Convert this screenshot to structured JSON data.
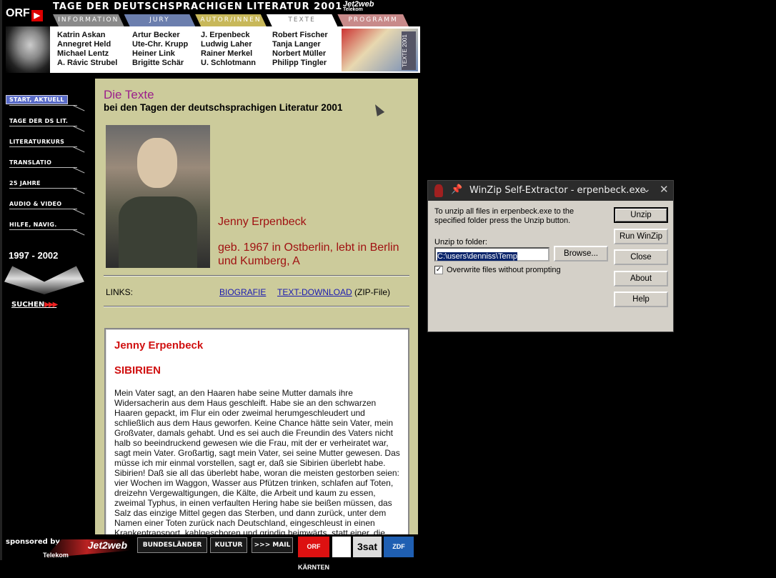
{
  "header": {
    "brand": "ORF",
    "title": "TAGE DER DEUTSCHSPRACHIGEN LITERATUR 2001",
    "sponsor": "Jet2web",
    "sponsor_sub": "Telekom",
    "tabs": [
      "INFORMATION",
      "JURY",
      "AUTOR/INNEN",
      "TEXTE",
      "PROGRAMM"
    ],
    "active_tab": "TEXTE",
    "banner_label": "TEXTE 2001"
  },
  "authors": [
    "Katrin Askan",
    "Artur Becker",
    "J. Erpenbeck",
    "Robert Fischer",
    "Annegret Held",
    "Ute-Chr. Krupp",
    "Ludwig Laher",
    "Tanja Langer",
    "Michael Lentz",
    "Heiner Link",
    "Rainer Merkel",
    "Norbert Müller",
    "A. Rávic Strubel",
    "Brigitte Schär",
    "U. Schlotmann",
    "Philipp Tingler"
  ],
  "sidebar": {
    "items": [
      {
        "label": "START, AKTUELL",
        "active": true
      },
      {
        "label": "TAGE DER DS LIT.",
        "active": false
      },
      {
        "label": "LITERATURKURS",
        "active": false
      },
      {
        "label": "TRANSLATIO",
        "active": false
      },
      {
        "label": "25 JAHRE",
        "active": false
      },
      {
        "label": "AUDIO & VIDEO",
        "active": false
      },
      {
        "label": "HILFE, NAVIG.",
        "active": false
      }
    ],
    "years": "1997 - 2002",
    "search": "SUCHEN",
    "search_arrows": "▶▶▶"
  },
  "main": {
    "heading": "Die Texte",
    "subheading": "bei den Tagen der deutschsprachigen Literatur 2001",
    "author_name": "Jenny Erpenbeck",
    "author_bio": "geb. 1967 in Ostberlin, lebt in Berlin und Kumberg, A",
    "links_label": "LINKS:",
    "link_bio": "BIOGRAFIE",
    "link_download": "TEXT-DOWNLOAD",
    "link_download_note": "(ZIP-File)",
    "text_author": "Jenny Erpenbeck",
    "text_title": "SIBIRIEN",
    "text_body": "Mein Vater sagt, an den Haaren habe seine Mutter damals ihre Widersacherin aus dem Haus geschleift. Habe sie an den schwarzen Haaren gepackt, im Flur ein oder zweimal herumgeschleudert und schließlich aus dem Haus geworfen. Keine Chance hätte sein Vater, mein Großvater, damals gehabt. Und es sei auch die Freundin des Vaters nicht halb so beeindruckend gewesen wie die Frau, mit der er verheiratet war, sagt mein Vater. Großartig, sagt mein Vater, sei seine Mutter gewesen. Das müsse ich mir einmal vorstellen, sagt er, daß sie Sibirien überlebt habe. Sibirien! Daß sie all das überlebt habe, woran die meisten gestorben seien: vier Wochen im Waggon, Wasser aus Pfützen trinken, schlafen auf Toten, dreizehn Vergewaltigungen, die Kälte, die Arbeit und kaum zu essen, zweimal Typhus, in einen verfaulten Hering habe sie beißen müssen, das Salz das einzige Mittel gegen das Sterben, und dann zurück, unter dem Namen einer Toten zurück nach Deutschland, eingeschleust in einen Krankentransport, kahlgeschoren und grindig heimwärts, statt einer, die"
  },
  "footer": {
    "sponsored_by": "sponsored by",
    "jet2web": "Jet2web",
    "telekom": "Telekom",
    "buttons": [
      "BUNDESLÄNDER",
      "KULTUR",
      ">>> MAIL"
    ],
    "logos": [
      "ORF KÄRNTEN",
      "",
      "3sat",
      "ZDF"
    ]
  },
  "dialog": {
    "title": "WinZip Self-Extractor - erpenbeck.exe",
    "message": "To unzip all files in erpenbeck.exe to the specified folder press the Unzip button.",
    "folder_label": "Unzip to folder:",
    "folder_value": "C:\\users\\denniss\\Temp",
    "browse": "Browse...",
    "overwrite_label": "Overwrite files without prompting",
    "overwrite_checked": true,
    "buttons": {
      "unzip": "Unzip",
      "run": "Run WinZip",
      "close": "Close",
      "about": "About",
      "help": "Help"
    }
  },
  "colors": {
    "main_bg": "#cccb9b",
    "heading": "#9b1f8b",
    "author": "#a01212",
    "link": "#1a1ab0"
  }
}
